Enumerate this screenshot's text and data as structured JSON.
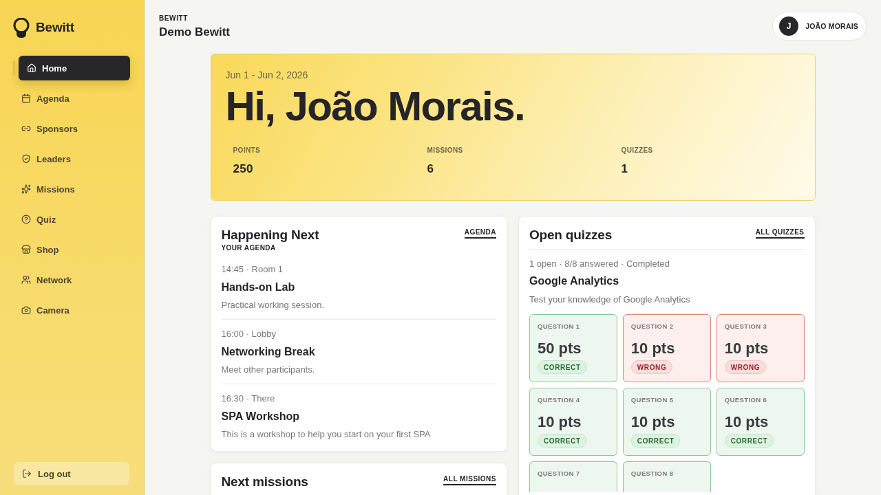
{
  "sidebar": {
    "brand": "Bewitt",
    "items": [
      {
        "label": "Home",
        "selected": true
      },
      {
        "label": "Agenda",
        "selected": false
      },
      {
        "label": "Sponsors",
        "selected": false
      },
      {
        "label": "Leaders",
        "selected": false
      },
      {
        "label": "Missions",
        "selected": false
      },
      {
        "label": "Quiz",
        "selected": false
      },
      {
        "label": "Shop",
        "selected": false
      },
      {
        "label": "Network",
        "selected": false
      },
      {
        "label": "Camera",
        "selected": false
      }
    ],
    "logout": "Log out"
  },
  "header": {
    "eyebrow": "BEWITT",
    "title": "Demo Bewitt",
    "user": {
      "initial": "J",
      "name": "JOÃO MORAIS"
    }
  },
  "hero": {
    "dates": "Jun 1 - Jun 2, 2026",
    "greeting": "Hi, João Morais.",
    "stats": [
      {
        "label": "POINTS",
        "value": "250"
      },
      {
        "label": "MISSIONS",
        "value": "6"
      },
      {
        "label": "QUIZZES",
        "value": "1"
      }
    ]
  },
  "agenda_card": {
    "title": "Happening Next",
    "link": "AGENDA",
    "subtitle": "YOUR AGENDA",
    "events": [
      {
        "meta": "14:45 · Room 1",
        "title": "Hands-on Lab",
        "description": "Practical working session."
      },
      {
        "meta": "16:00 · Lobby",
        "title": "Networking Break",
        "description": "Meet other participants."
      },
      {
        "meta": "16:30 · There",
        "title": "SPA Workshop",
        "description": "This is a workshop to help you start on your first SPA"
      }
    ]
  },
  "missions_card": {
    "title": "Next missions",
    "link": "ALL MISSIONS"
  },
  "quizzes_card": {
    "title": "Open quizzes",
    "link": "ALL QUIZZES",
    "summary": "1 open · 8/8 answered · Completed",
    "quiz": {
      "name": "Google Analytics",
      "description": "Test your knowledge of Google Analytics"
    },
    "questions": [
      {
        "label": "QUESTION 1",
        "points": "50 pts",
        "kind": "correct",
        "result": "CORRECT"
      },
      {
        "label": "QUESTION 2",
        "points": "10 pts",
        "kind": "wrong",
        "result": "WRONG"
      },
      {
        "label": "QUESTION 3",
        "points": "10 pts",
        "kind": "wrong",
        "result": "WRONG"
      },
      {
        "label": "QUESTION 4",
        "points": "10 pts",
        "kind": "correct",
        "result": "CORRECT"
      },
      {
        "label": "QUESTION 5",
        "points": "10 pts",
        "kind": "correct",
        "result": "CORRECT"
      },
      {
        "label": "QUESTION 6",
        "points": "10 pts",
        "kind": "correct",
        "result": "CORRECT"
      },
      {
        "label": "QUESTION 7",
        "kind": "correct"
      },
      {
        "label": "QUESTION 8",
        "kind": "correct"
      }
    ]
  }
}
